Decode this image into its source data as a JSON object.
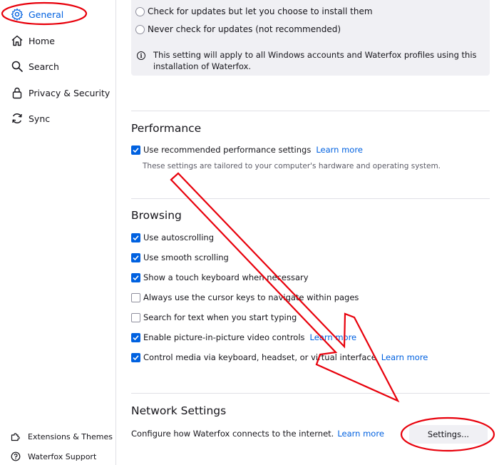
{
  "sidebar": {
    "items": [
      {
        "label": "General",
        "icon": "gear-icon",
        "active": true
      },
      {
        "label": "Home",
        "icon": "home-icon"
      },
      {
        "label": "Search",
        "icon": "search-icon"
      },
      {
        "label": "Privacy & Security",
        "icon": "lock-icon"
      },
      {
        "label": "Sync",
        "icon": "sync-icon"
      }
    ],
    "footer": [
      {
        "label": "Extensions & Themes",
        "icon": "puzzle-icon"
      },
      {
        "label": "Waterfox Support",
        "icon": "help-icon"
      }
    ]
  },
  "updates": {
    "options": [
      "Check for updates but let you choose to install them",
      "Never check for updates (not recommended)"
    ],
    "info": "This setting will apply to all Windows accounts and Waterfox profiles using this installation of Waterfox."
  },
  "performance": {
    "title": "Performance",
    "recommended": {
      "label": "Use recommended performance settings",
      "checked": true,
      "link": "Learn more"
    },
    "description": "These settings are tailored to your computer's hardware and operating system."
  },
  "browsing": {
    "title": "Browsing",
    "options": [
      {
        "label": "Use autoscrolling",
        "checked": true
      },
      {
        "label": "Use smooth scrolling",
        "checked": true
      },
      {
        "label": "Show a touch keyboard when necessary",
        "checked": true
      },
      {
        "label": "Always use the cursor keys to navigate within pages",
        "checked": false
      },
      {
        "label": "Search for text when you start typing",
        "checked": false
      },
      {
        "label": "Enable picture-in-picture video controls",
        "checked": true,
        "link": "Learn more"
      },
      {
        "label": "Control media via keyboard, headset, or virtual interface",
        "checked": true,
        "link": "Learn more"
      }
    ]
  },
  "network": {
    "title": "Network Settings",
    "description": "Configure how Waterfox connects to the internet.",
    "link": "Learn more",
    "button": "Settings..."
  },
  "colors": {
    "accent": "#0061e0",
    "annotation": "#e8000b",
    "panel": "#f0f0f4"
  }
}
